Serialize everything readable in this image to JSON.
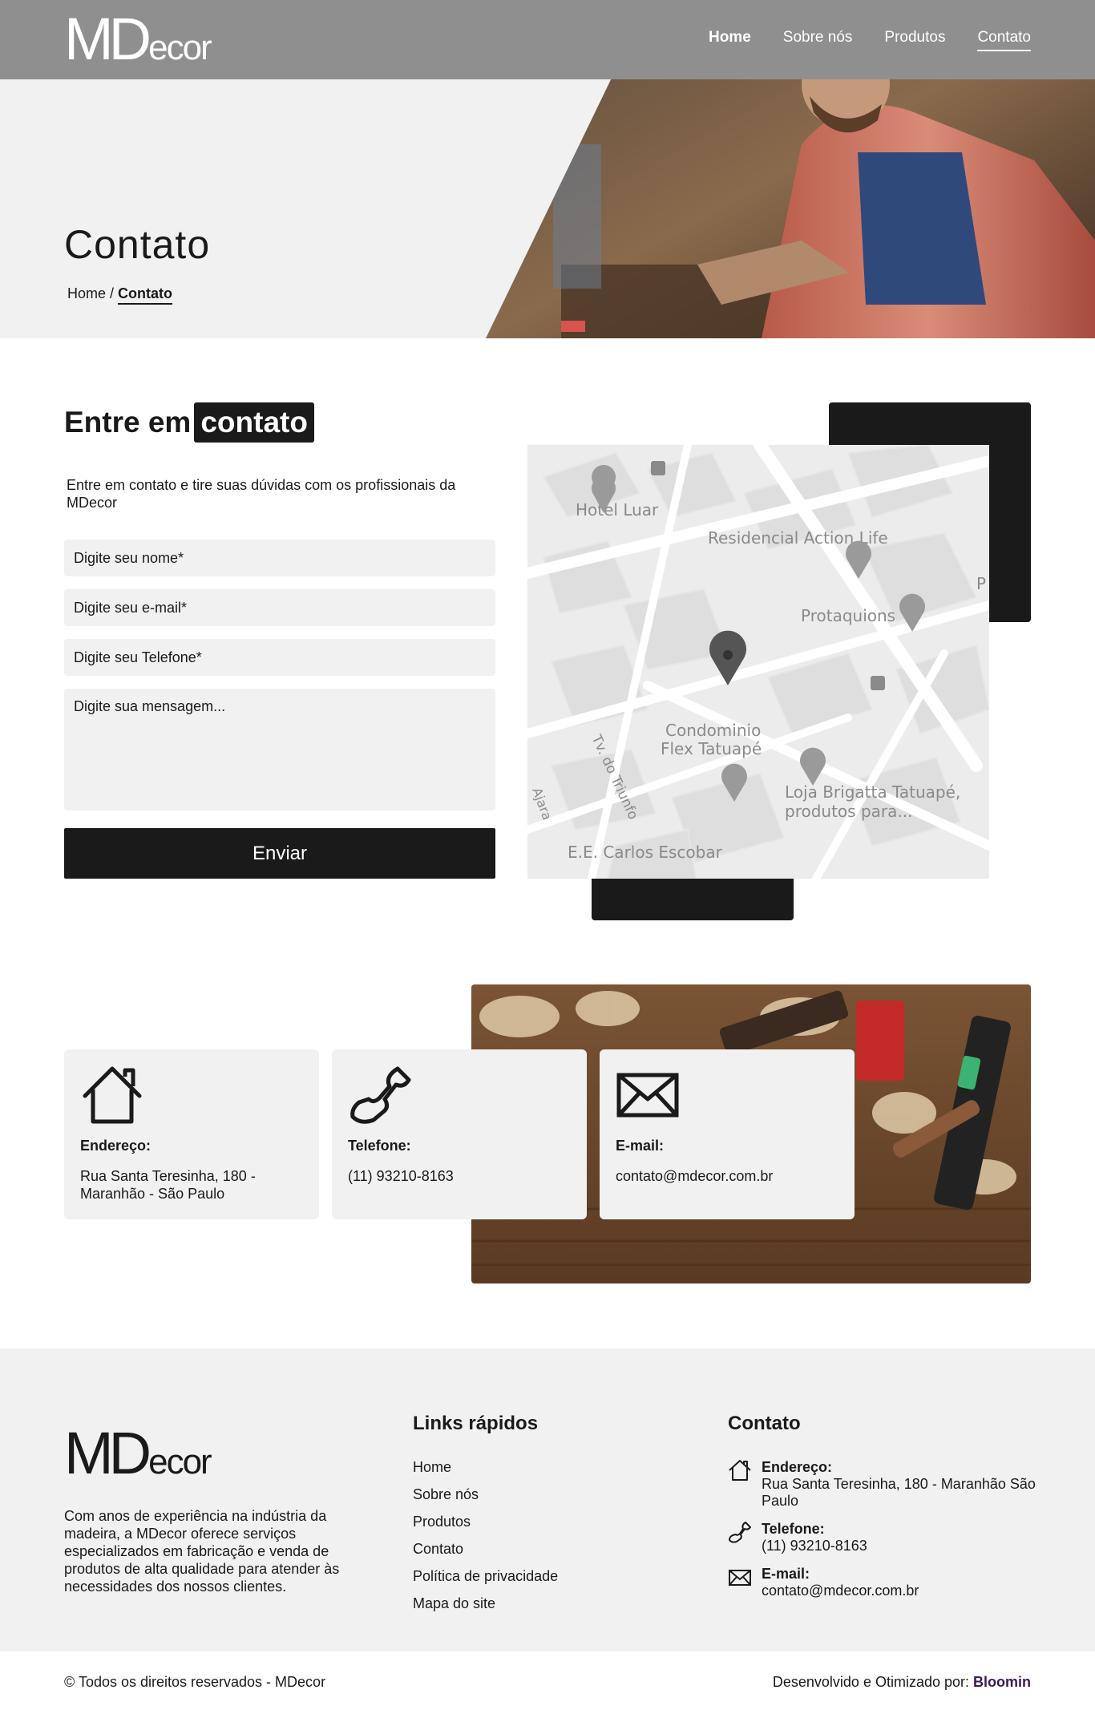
{
  "header": {
    "logo_main": "MD",
    "logo_rest": "ecor",
    "nav": [
      {
        "label": "Home"
      },
      {
        "label": "Sobre nós"
      },
      {
        "label": "Produtos"
      },
      {
        "label": "Contato"
      }
    ]
  },
  "hero": {
    "title": "Contato",
    "breadcrumb_home": "Home",
    "breadcrumb_sep": " / ",
    "breadcrumb_current": "Contato"
  },
  "contact_form": {
    "title_prefix": "Entre em",
    "title_highlight": "contato",
    "description": "Entre em contato e tire suas dúvidas com os profissionais da MDecor",
    "name_placeholder": "Digite seu nome*",
    "email_placeholder": "Digite seu e-mail*",
    "phone_placeholder": "Digite seu Telefone*",
    "message_placeholder": "Digite sua mensagem...",
    "submit_label": "Enviar"
  },
  "map": {
    "places": [
      {
        "label": "Hotel Luar"
      },
      {
        "label": "Residencial Action Life"
      },
      {
        "label": "Protaquions"
      },
      {
        "label": "Condominio"
      },
      {
        "label": "Flex Tatuapé"
      },
      {
        "label": "Loja Brigatta Tatuapé,"
      },
      {
        "label": "produtos para..."
      },
      {
        "label": "E.E. Carlos Escobar"
      },
      {
        "label": "Tv. do Triunfo"
      },
      {
        "label": "Ajara"
      },
      {
        "label": "P"
      }
    ]
  },
  "info_cards": [
    {
      "icon": "house-icon",
      "label": "Endereço:",
      "value": "Rua Santa Teresinha, 180 - Maranhão - São Paulo"
    },
    {
      "icon": "phone-icon",
      "label": "Telefone:",
      "value": "(11) 93210-8163"
    },
    {
      "icon": "envelope-icon",
      "label": "E-mail:",
      "value": "contato@mdecor.com.br"
    }
  ],
  "footer": {
    "logo_main": "MD",
    "logo_rest": "ecor",
    "about": "Com anos de experiência na indústria da madeira, a MDecor oferece serviços especializados em fabricação e venda de produtos de alta qualidade para atender às necessidades dos nossos clientes.",
    "links_title": "Links rápidos",
    "links": [
      {
        "label": "Home"
      },
      {
        "label": "Sobre nós"
      },
      {
        "label": "Produtos"
      },
      {
        "label": "Contato"
      },
      {
        "label": "Política de privacidade"
      },
      {
        "label": "Mapa do site"
      }
    ],
    "contact_title": "Contato",
    "address_label": "Endereço:",
    "address_value": "Rua Santa Teresinha, 180 - Maranhão São Paulo",
    "phone_label": "Telefone:",
    "phone_value": "(11) 93210-8163",
    "email_label": "E-mail:",
    "email_value": "contato@mdecor.com.br"
  },
  "bottom": {
    "copyright": "© Todos os direitos reservados - MDecor",
    "dev_prefix": "Desenvolvido e Otimizado por: ",
    "dev_brand": "Bloomin"
  },
  "colors": {
    "dark": "#1a1a1a",
    "topbar": "#8f8f8f",
    "panel": "#f1f1f1",
    "brand_link": "#3b1a5a"
  }
}
